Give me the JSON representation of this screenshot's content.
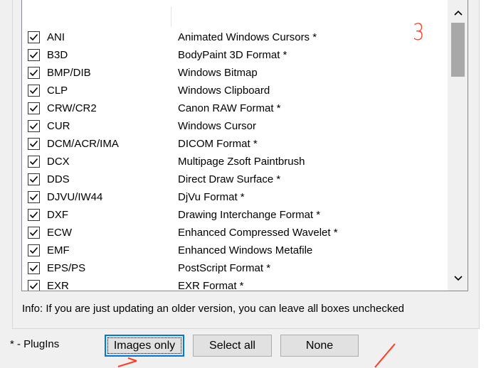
{
  "formats": [
    {
      "ext": "ANI",
      "desc": "Animated Windows Cursors *",
      "checked": true
    },
    {
      "ext": "B3D",
      "desc": "BodyPaint 3D Format *",
      "checked": true
    },
    {
      "ext": "BMP/DIB",
      "desc": "Windows Bitmap",
      "checked": true
    },
    {
      "ext": "CLP",
      "desc": "Windows Clipboard",
      "checked": true
    },
    {
      "ext": "CRW/CR2",
      "desc": "Canon RAW Format *",
      "checked": true
    },
    {
      "ext": "CUR",
      "desc": "Windows Cursor",
      "checked": true
    },
    {
      "ext": "DCM/ACR/IMA",
      "desc": "DICOM Format *",
      "checked": true
    },
    {
      "ext": "DCX",
      "desc": "Multipage Zsoft Paintbrush",
      "checked": true
    },
    {
      "ext": "DDS",
      "desc": "Direct Draw Surface *",
      "checked": true
    },
    {
      "ext": "DJVU/IW44",
      "desc": "DjVu Format *",
      "checked": true
    },
    {
      "ext": "DXF",
      "desc": "Drawing Interchange Format *",
      "checked": true
    },
    {
      "ext": "ECW",
      "desc": "Enhanced Compressed Wavelet *",
      "checked": true
    },
    {
      "ext": "EMF",
      "desc": "Enhanced Windows Metafile",
      "checked": true
    },
    {
      "ext": "EPS/PS",
      "desc": "PostScript Format *",
      "checked": true
    },
    {
      "ext": "EXR",
      "desc": "EXR Format *",
      "checked": true
    }
  ],
  "info_text": "Info: If you are just updating an older version, you can leave all boxes unchecked",
  "plugins_note": "* - PlugIns",
  "buttons": {
    "images_only": "Images only",
    "select_all": "Select all",
    "none": "None"
  },
  "annotation": {
    "step_number": "3",
    "color": "#ff3b1f"
  },
  "colors": {
    "focus_border": "#0078d7",
    "scroll_thumb": "#a8a8a8"
  }
}
